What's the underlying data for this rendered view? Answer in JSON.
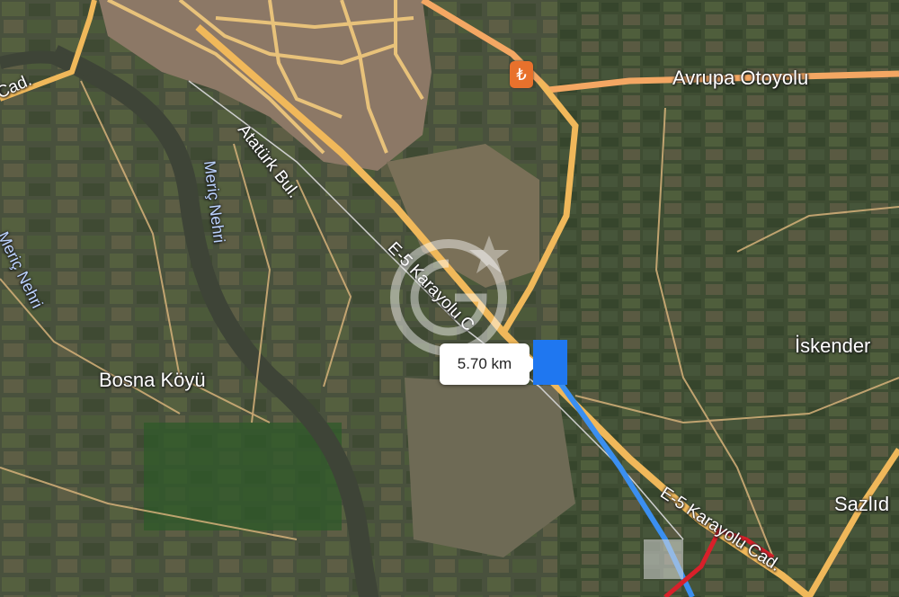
{
  "map": {
    "view": "satellite-hybrid",
    "labels": {
      "cadde_nw": "Cad.",
      "ataturk": "Atatürk Bul.",
      "e5_upper": "E-5 Karayolu C",
      "e5_lower": "E-5 Karayolu Cad.",
      "avrupa": "Avrupa Otoyolu",
      "meric_1": "Meriç Nehri",
      "meric_2": "Meriç Nehri",
      "bosna": "Bosna Köyü",
      "iskender": "İskender",
      "sazlidere": "Sazlıd"
    },
    "distance": "5.70 km",
    "toll_symbol": "₺",
    "colors": {
      "road_major": "#f0b85a",
      "road_highway": "#f4a763",
      "road_minor": "#d6b27a",
      "route_blue": "#3b8ff0",
      "route_red": "#d8202a",
      "marker": "#1f77f0",
      "river_label": "#bcd3ff"
    },
    "icons": [
      "toll-icon",
      "route-end-marker",
      "watermark-icon"
    ]
  }
}
